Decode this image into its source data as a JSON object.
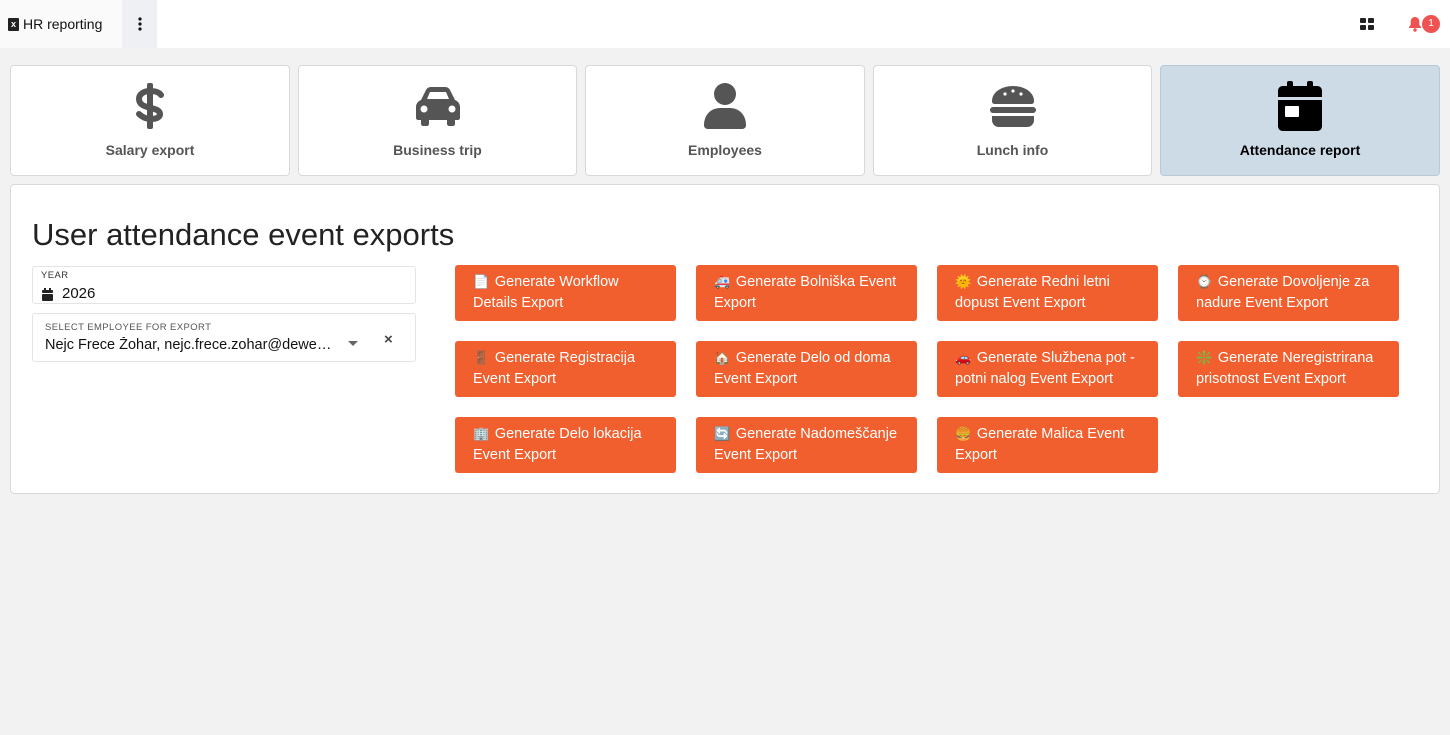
{
  "app": {
    "title": "HR reporting"
  },
  "header": {
    "notifications_count": "1"
  },
  "nav": {
    "tiles": [
      {
        "label": "Salary export",
        "icon": "dollar-icon"
      },
      {
        "label": "Business trip",
        "icon": "car-icon"
      },
      {
        "label": "Employees",
        "icon": "user-icon"
      },
      {
        "label": "Lunch info",
        "icon": "hamburger-icon"
      },
      {
        "label": "Attendance report",
        "icon": "calendar-icon",
        "active": true
      }
    ]
  },
  "main": {
    "title": "User attendance event exports",
    "year_field": {
      "label": "YEAR",
      "value": "2026"
    },
    "employee_field": {
      "label": "SELECT EMPLOYEE FOR EXPORT",
      "value": "Nejc Frece Žohar, nejc.frece.zohar@dewesoft.com"
    },
    "buttons": [
      {
        "emoji": "📄",
        "label": "Generate Workflow Details Export"
      },
      {
        "emoji": "🚑",
        "label": "Generate Bolniška Event Export"
      },
      {
        "emoji": "🌞",
        "label": "Generate Redni letni dopust Event Export"
      },
      {
        "emoji": "⌚",
        "label": "Generate Dovoljenje za nadure Event Export"
      },
      {
        "emoji": "🚪",
        "label": "Generate Registracija Event Export"
      },
      {
        "emoji": "🏠",
        "label": "Generate Delo od doma Event Export"
      },
      {
        "emoji": "🚗",
        "label": "Generate Službena pot - potni nalog Event Export"
      },
      {
        "emoji": "❇️",
        "label": "Generate Neregistrirana prisotnost Event Export"
      },
      {
        "emoji": "🏢",
        "label": "Generate Delo lokacija Event Export"
      },
      {
        "emoji": "🔄",
        "label": "Generate Nadomeščanje Event Export"
      },
      {
        "emoji": "🍔",
        "label": "Generate Malica Event Export"
      }
    ]
  },
  "colors": {
    "accent": "#f15f2e",
    "active_tile": "#cddbe7",
    "badge": "#f05252"
  }
}
